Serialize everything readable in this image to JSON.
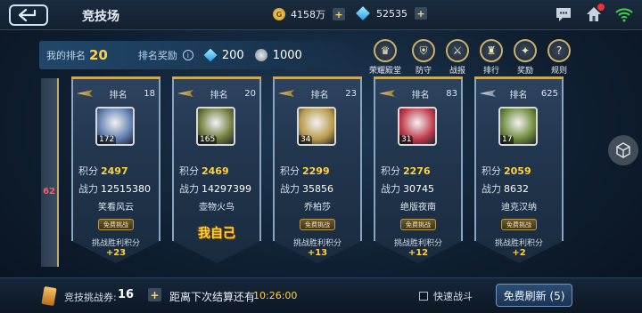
{
  "header": {
    "title": "竞技场",
    "gold": "4158万",
    "diamonds": "52535",
    "plus": "+"
  },
  "rank": {
    "my_rank_label": "我的排名",
    "my_rank_value": "20",
    "reward_label": "排名奖励",
    "reward_diamonds": "200",
    "reward_medals": "1000"
  },
  "menu": [
    {
      "label": "荣耀殿堂",
      "icon": "hall-of-fame-icon"
    },
    {
      "label": "防守",
      "icon": "shield-icon"
    },
    {
      "label": "战报",
      "icon": "battle-report-icon"
    },
    {
      "label": "排行",
      "icon": "trophy-icon"
    },
    {
      "label": "奖励",
      "icon": "gift-icon"
    },
    {
      "label": "规则",
      "icon": "question-icon"
    }
  ],
  "partial_card_number": "62",
  "cards": [
    {
      "rank_label": "排名",
      "rank": "18",
      "level": "172",
      "score_label": "积分",
      "score": "2497",
      "power_label": "战力",
      "power": "12515380",
      "name": "笑看风云",
      "button": "免费挑战",
      "reward_label": "挑战胜利积分",
      "reward": "+23",
      "self": false,
      "wing": "gold",
      "avatar_color": "#5f7fb0"
    },
    {
      "rank_label": "排名",
      "rank": "20",
      "level": "165",
      "score_label": "积分",
      "score": "2469",
      "power_label": "战力",
      "power": "14297399",
      "name": "壶物火鸟",
      "self_label": "我自己",
      "self": true,
      "wing": "gold",
      "avatar_color": "#6e7b3a"
    },
    {
      "rank_label": "排名",
      "rank": "23",
      "level": "34",
      "score_label": "积分",
      "score": "2299",
      "power_label": "战力",
      "power": "35856",
      "name": "乔柏莎",
      "button": "免费挑战",
      "reward_label": "挑战胜利积分",
      "reward": "+13",
      "self": false,
      "wing": "gold",
      "avatar_color": "#b89a4a"
    },
    {
      "rank_label": "排名",
      "rank": "83",
      "level": "31",
      "score_label": "积分",
      "score": "2276",
      "power_label": "战力",
      "power": "30745",
      "name": "绝版夜南",
      "button": "免费挑战",
      "reward_label": "挑战胜利积分",
      "reward": "+12",
      "self": false,
      "wing": "gold",
      "avatar_color": "#c0394a"
    },
    {
      "rank_label": "排名",
      "rank": "625",
      "level": "17",
      "score_label": "积分",
      "score": "2059",
      "power_label": "战力",
      "power": "8632",
      "name": "迪克汉纳",
      "button": "免费挑战",
      "reward_label": "挑战胜利积分",
      "reward": "+2",
      "self": false,
      "wing": "silver",
      "avatar_color": "#6c8a3b"
    }
  ],
  "footer": {
    "ticket_label": "竞技挑战券:",
    "ticket_count": "16",
    "plus": "+",
    "next_settle_label": "距离下次结算还有",
    "next_settle_time": "10:26:00",
    "quick_battle_label": "快速战斗",
    "refresh_label": "免费刷新 (5)"
  }
}
